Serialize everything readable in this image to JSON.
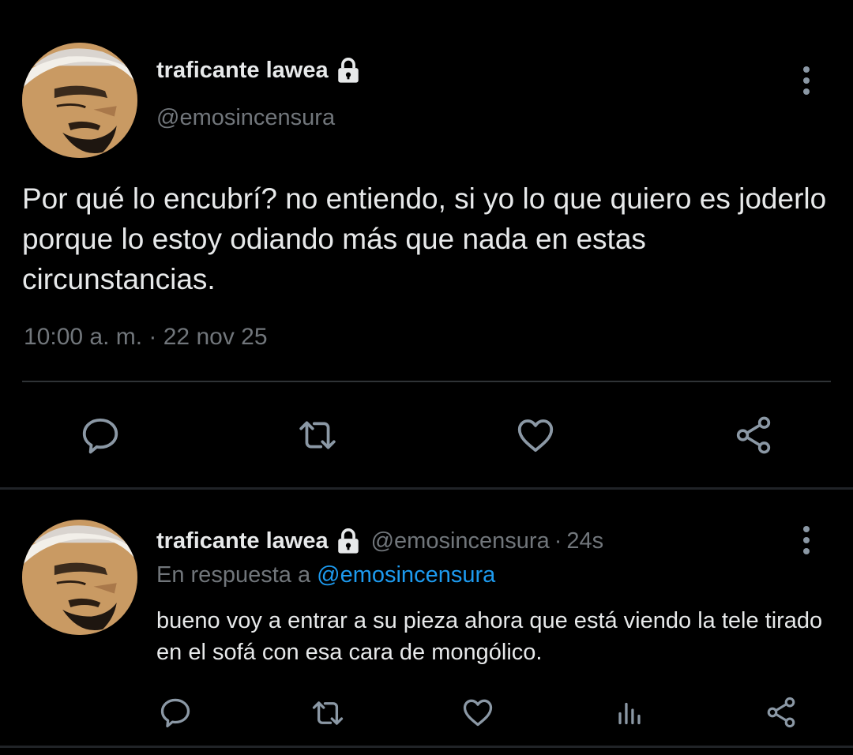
{
  "main_tweet": {
    "display_name": "traficante lawea",
    "handle": "@emosincensura",
    "text": "Por qué lo encubrí? no entiendo, si yo lo que quiero es joderlo porque lo estoy odiando más que nada en estas circunstancias.",
    "time": "10:00 a. m. · 22 nov 25",
    "actions": [
      "reply-icon",
      "retweet-icon",
      "like-icon",
      "share-icon"
    ]
  },
  "reply_tweet": {
    "display_name": "traficante lawea",
    "handle": "@emosincensura",
    "separator": "·",
    "age": "24s",
    "reply_prefix": "En respuesta a",
    "reply_mention": "@emosincensura",
    "text": "bueno voy a entrar a su pieza ahora que está viendo la tele tirado en el sofá con esa cara de mongólico.",
    "actions": [
      "reply-icon",
      "retweet-icon",
      "like-icon",
      "analytics-icon",
      "share-icon"
    ]
  },
  "colors": {
    "background": "#000000",
    "primary_text": "#e7e9ea",
    "secondary_text": "#71767b",
    "link": "#1d9bf0",
    "icon": "#8b98a5",
    "divider": "#2f3336"
  }
}
